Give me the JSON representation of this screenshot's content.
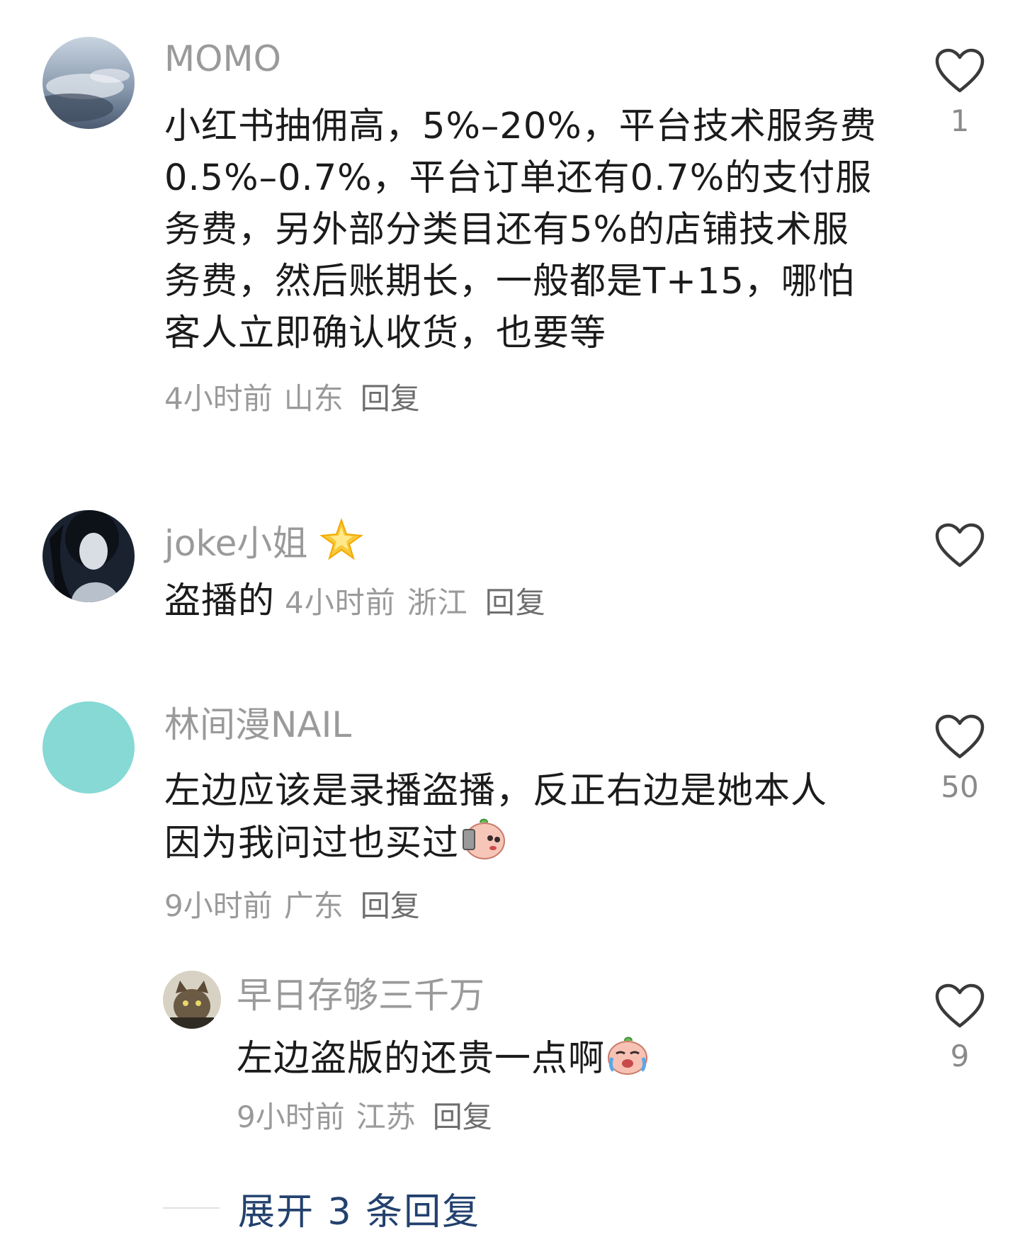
{
  "comments": [
    {
      "username": "MOMO",
      "content": "小红书抽佣高，5%–20%，平台技术服务费0.5%–0.7%，平台订单还有0.7%的支付服务费，另外部分类目还有5%的店铺技术服务费，然后账期长，一般都是T+15，哪怕客人立即确认收货，也要等",
      "time": "4小时前",
      "location": "山东",
      "reply_label": "回复",
      "likes": "1"
    },
    {
      "username": "joke小姐",
      "content": "盗播的",
      "time": "4小时前",
      "location": "浙江",
      "reply_label": "回复",
      "likes": ""
    },
    {
      "username": "林间漫NAIL",
      "content": "左边应该是录播盗播，反正右边是她本人 因为我问过也买过",
      "time": "9小时前",
      "location": "广东",
      "reply_label": "回复",
      "likes": "50"
    }
  ],
  "reply": {
    "username": "早日存够三千万",
    "content": "左边盗版的还贵一点啊",
    "time": "9小时前",
    "location": "江苏",
    "reply_label": "回复",
    "likes": "9"
  },
  "expand_label": "展开 3 条回复",
  "colors": {
    "username": "#9a9a9a",
    "meta": "#9a9a9a",
    "expand": "#23416e",
    "heart": "#3a3a3a"
  }
}
